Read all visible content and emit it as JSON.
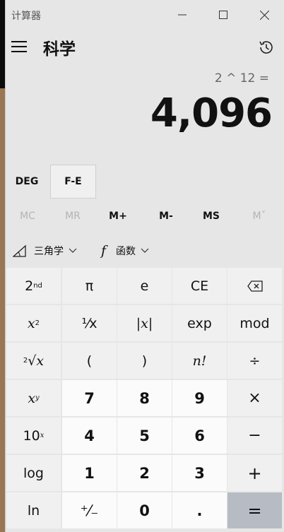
{
  "app": {
    "title": "计算器",
    "mode": "科学"
  },
  "display": {
    "expression": "2 ^ 12 =",
    "result": "4,096"
  },
  "angle": {
    "deg": "DEG",
    "fe": "F-E"
  },
  "memory": [
    {
      "label": "MC",
      "enabled": false
    },
    {
      "label": "MR",
      "enabled": false
    },
    {
      "label": "M+",
      "enabled": true
    },
    {
      "label": "M-",
      "enabled": true
    },
    {
      "label": "MS",
      "enabled": true
    },
    {
      "label": "Mˇ",
      "enabled": false
    }
  ],
  "functions": {
    "trig": "三角学",
    "func": "函数",
    "func_symbol": "f"
  },
  "keys": {
    "second": "2",
    "second_sup": "nd",
    "pi": "π",
    "e": "e",
    "ce": "CE",
    "x": "x",
    "x_sq_sup": "2",
    "reciprocal": "¹⁄x",
    "abs": "|x|",
    "exp": "exp",
    "mod": "mod",
    "root_index": "2",
    "root": "√x",
    "lparen": "(",
    "rparen": ")",
    "fact": "n!",
    "divide": "÷",
    "xy_sup": "y",
    "ten": "10",
    "ten_sup": "x",
    "log": "log",
    "ln": "ln",
    "negate": "⁺⁄₋",
    "n7": "7",
    "n8": "8",
    "n9": "9",
    "multiply": "×",
    "n4": "4",
    "n5": "5",
    "n6": "6",
    "minus": "−",
    "n1": "1",
    "n2": "2",
    "n3": "3",
    "plus": "+",
    "n0": "0",
    "dot": ".",
    "equals": "="
  }
}
